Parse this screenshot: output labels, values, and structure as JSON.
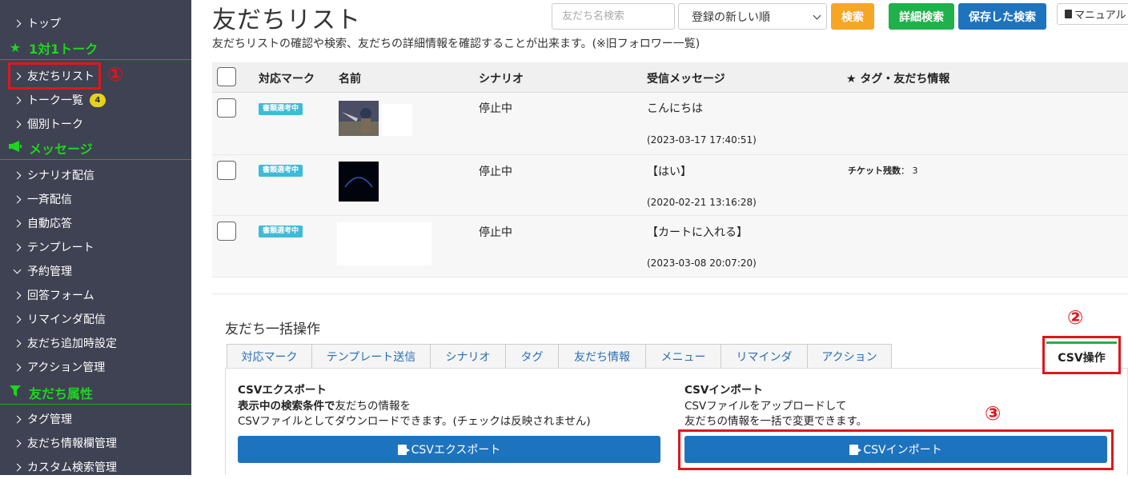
{
  "sidebar": {
    "items": [
      {
        "label": "トップ"
      },
      {
        "label": "友だちリスト"
      },
      {
        "label": "トーク一覧",
        "badge": "4"
      },
      {
        "label": "個別トーク"
      },
      {
        "label": "シナリオ配信"
      },
      {
        "label": "一斉配信"
      },
      {
        "label": "自動応答"
      },
      {
        "label": "テンプレート"
      },
      {
        "label": "予約管理"
      },
      {
        "label": "回答フォーム"
      },
      {
        "label": "リマインダ配信"
      },
      {
        "label": "友だち追加時設定"
      },
      {
        "label": "アクション管理"
      },
      {
        "label": "タグ管理"
      },
      {
        "label": "友だち情報欄管理"
      },
      {
        "label": "カスタム検索管理"
      }
    ],
    "sections": [
      {
        "label": "1対1トーク",
        "icon": "star-icon"
      },
      {
        "label": "メッセージ",
        "icon": "megaphone-icon"
      },
      {
        "label": "友だち属性",
        "icon": "filter-icon"
      }
    ]
  },
  "annotations": {
    "one": "①",
    "two": "②",
    "three": "③"
  },
  "header": {
    "title": "友だちリスト",
    "description": "友だちリストの確認や検索、友だちの詳細情報を確認することが出来ます。(※旧フォロワー一覧)",
    "search_placeholder": "友だち名検索",
    "sort_selected": "登録の新しい順",
    "search_button": "検索",
    "detail_search_button": "詳細検索",
    "saved_search_button": "保存した検索",
    "manual_button": "マニュアル"
  },
  "table": {
    "headers": [
      "対応マーク",
      "名前",
      "シナリオ",
      "受信メッセージ",
      "★ タグ・友だち情報"
    ],
    "rows": [
      {
        "mark": "書類選考中",
        "scenario": "停止中",
        "message": "こんにちは",
        "timestamp": "(2023-03-17 17:40:51)",
        "info_label": "",
        "info_value": ""
      },
      {
        "mark": "書類選考中",
        "scenario": "停止中",
        "message": "【はい】",
        "timestamp": "(2020-02-21 13:16:28)",
        "info_label": "チケット残数",
        "info_value": "3"
      },
      {
        "mark": "書類選考中",
        "scenario": "停止中",
        "message": "【カートに入れる】",
        "timestamp": "(2023-03-08 20:07:20)",
        "info_label": "",
        "info_value": ""
      }
    ]
  },
  "bulk": {
    "title": "友だち一括操作",
    "tabs": [
      "対応マーク",
      "テンプレート送信",
      "シナリオ",
      "タグ",
      "友だち情報",
      "メニュー",
      "リマインダ",
      "アクション"
    ],
    "active_tab": "CSV操作",
    "export": {
      "heading": "CSVエクスポート",
      "line1_bold": "表示中の検索条件で",
      "line1_rest": "友だちの情報を",
      "line2": "CSVファイルとしてダウンロードできます。(チェックは反映されません)",
      "button": "CSVエクスポート"
    },
    "import": {
      "heading": "CSVインポート",
      "line1": "CSVファイルをアップロードして",
      "line2": "友だちの情報を一括で変更できます。",
      "button": "CSVインポート"
    }
  }
}
